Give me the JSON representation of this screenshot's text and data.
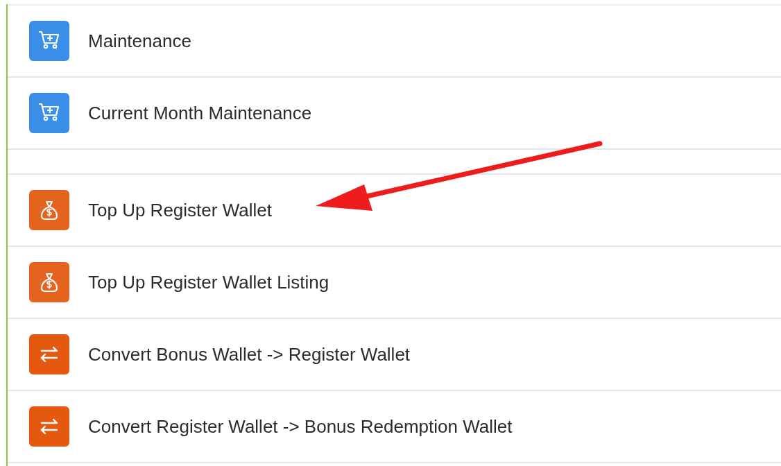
{
  "groups": [
    {
      "items": [
        {
          "label": "Maintenance",
          "kind": "cart",
          "color": "#3b8fe8"
        },
        {
          "label": "Current Month Maintenance",
          "kind": "cart",
          "color": "#3b8fe8"
        }
      ]
    },
    {
      "items": [
        {
          "label": "Top Up Register Wallet",
          "kind": "money-bag",
          "color": "#e4641f"
        },
        {
          "label": "Top Up Register Wallet Listing",
          "kind": "money-bag",
          "color": "#e4641f"
        },
        {
          "label": "Convert Bonus Wallet -> Register Wallet",
          "kind": "exchange",
          "color": "#e4580f"
        },
        {
          "label": "Convert Register Wallet -> Bonus Redemption Wallet",
          "kind": "exchange",
          "color": "#e4580f"
        }
      ]
    }
  ],
  "annotation": {
    "kind": "arrow"
  }
}
